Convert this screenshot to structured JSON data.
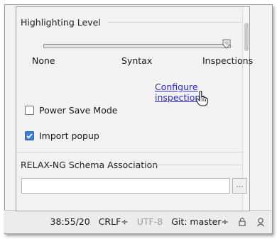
{
  "highlighting": {
    "title": "Highlighting Level",
    "levels": [
      "None",
      "Syntax",
      "Inspections"
    ],
    "selected_level": "Inspections",
    "configure_link": "Configure inspections"
  },
  "options": {
    "power_save_label": "Power Save Mode",
    "power_save_checked": false,
    "import_popup_label": "Import popup",
    "import_popup_checked": true
  },
  "schema": {
    "title": "RELAX-NG Schema Association",
    "input_value": "",
    "browse_label": "..."
  },
  "statusbar": {
    "position": "38:55/20",
    "line_separator": "CRLF÷",
    "encoding": "UTF-8",
    "vcs": "Git: master÷"
  },
  "icons": [
    "lock-icon",
    "inspector-icon",
    "hand-cursor-icon",
    "check-icon",
    "slider-thumb-icon"
  ]
}
